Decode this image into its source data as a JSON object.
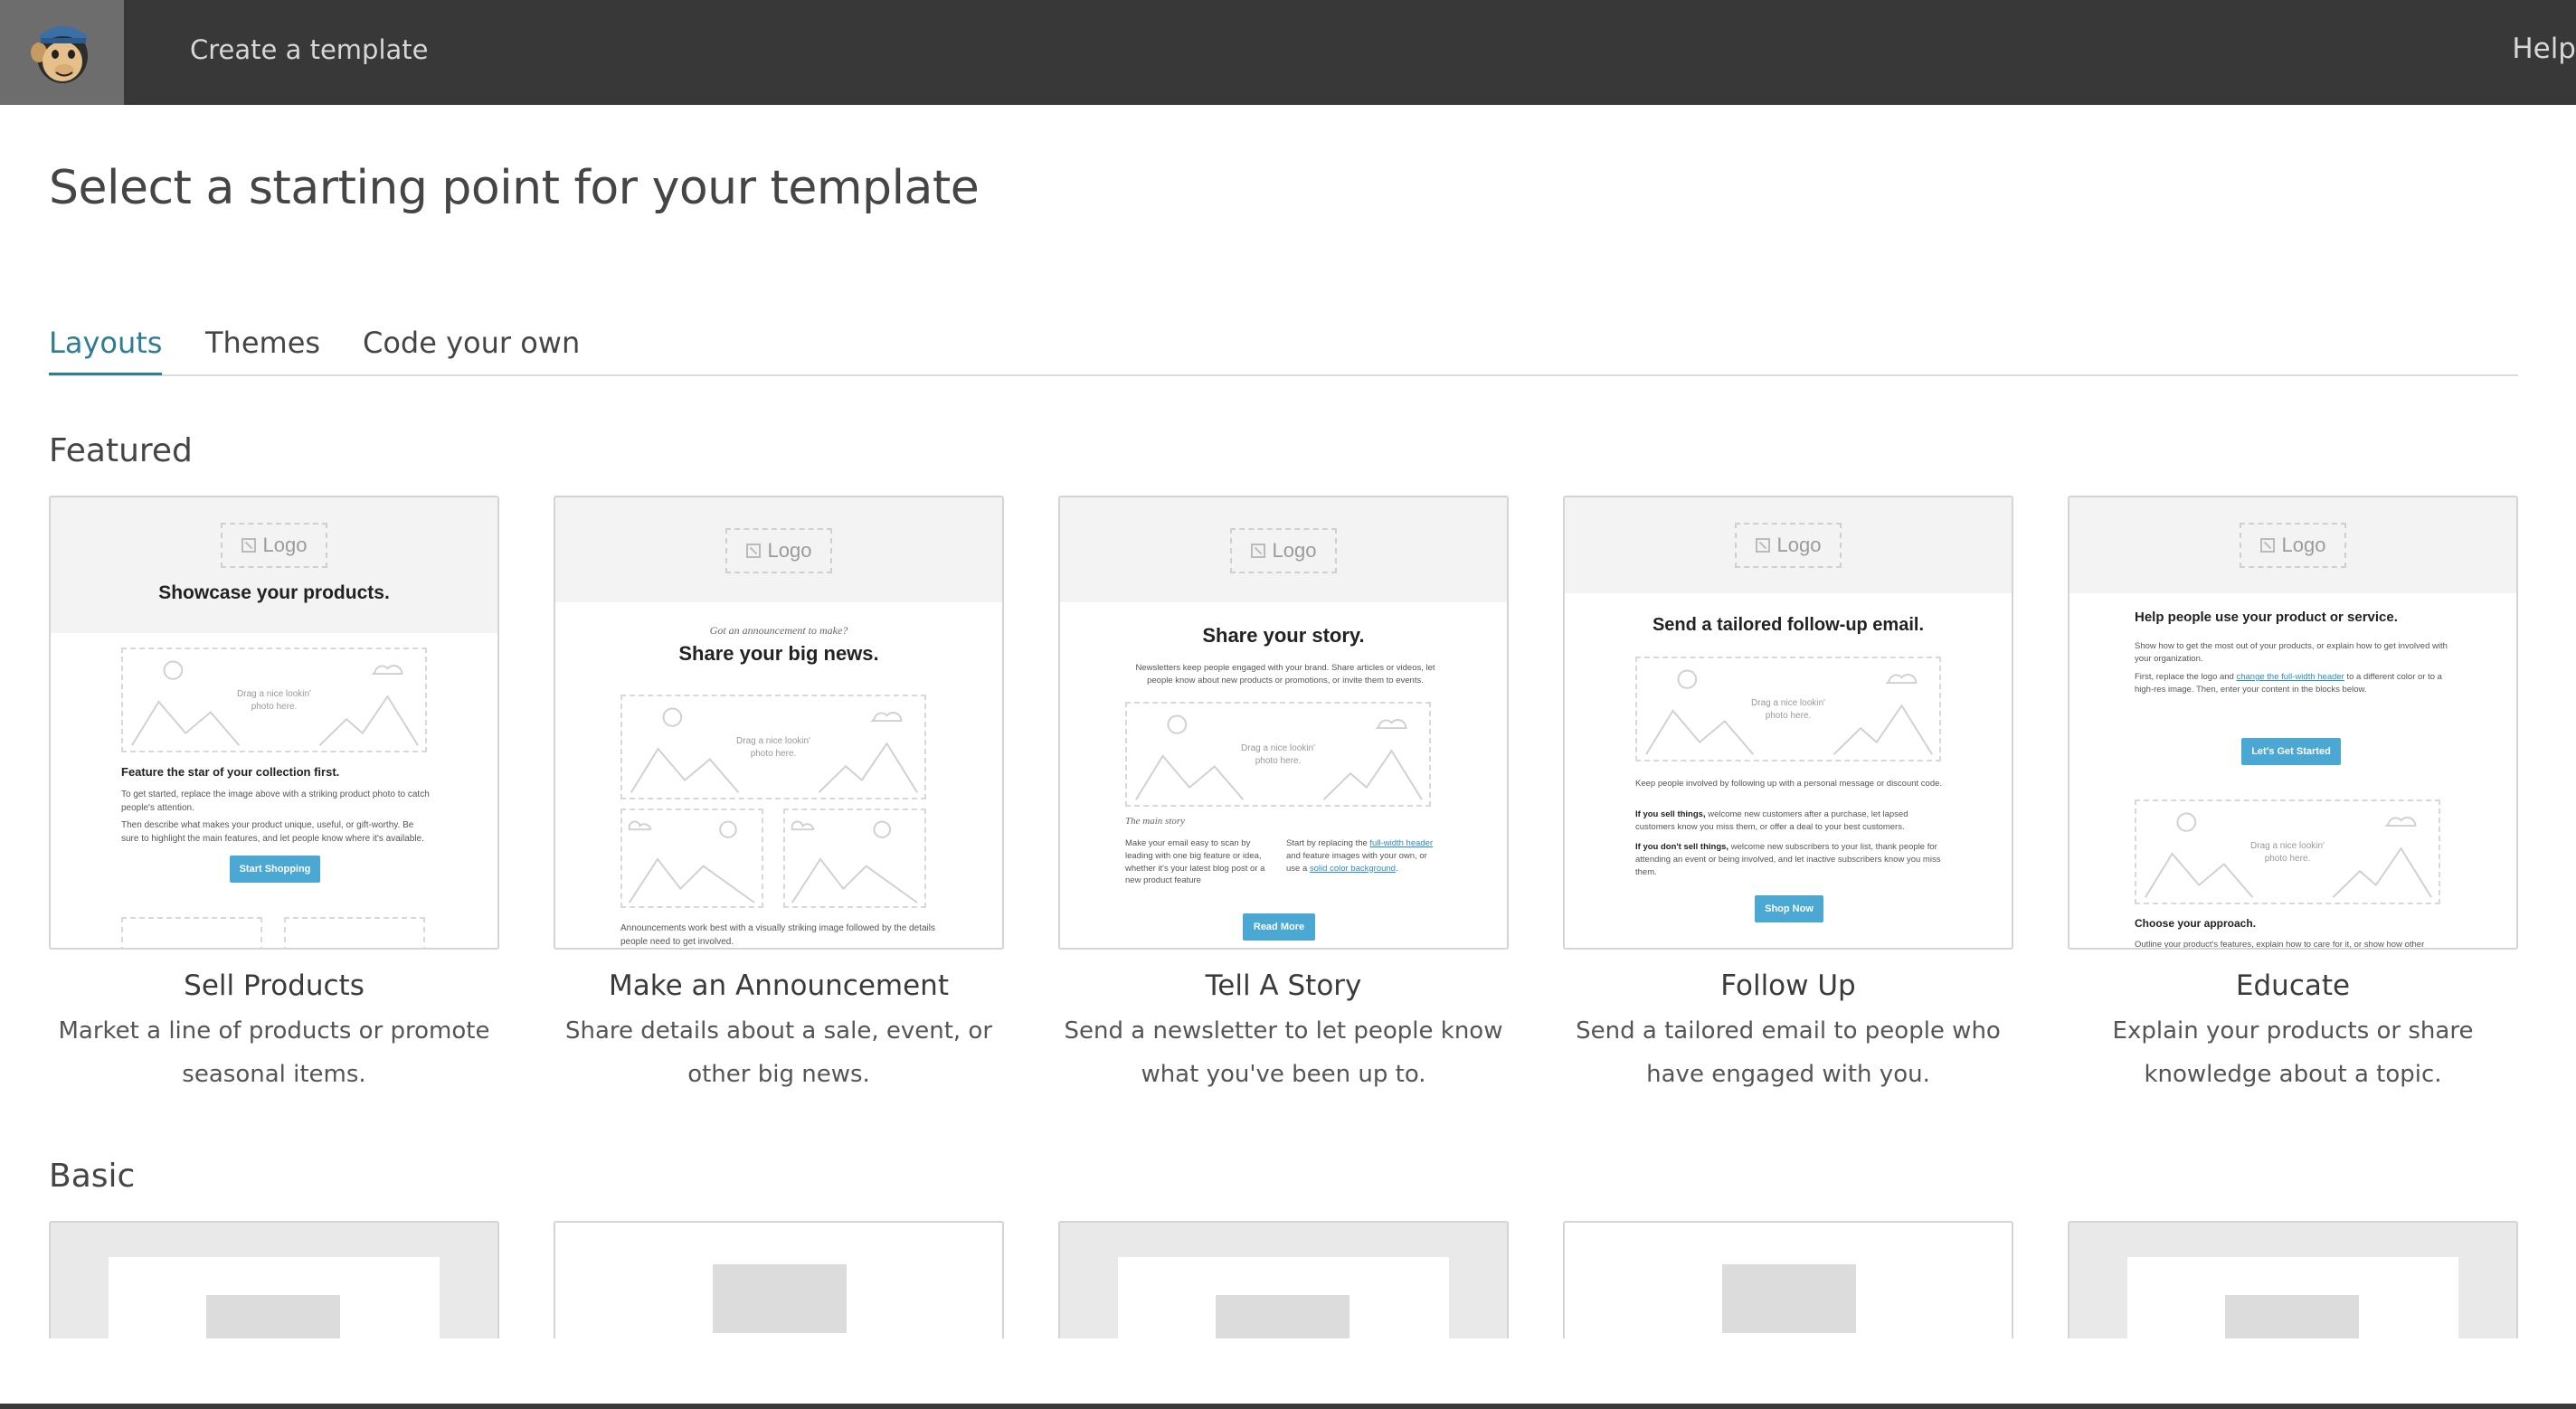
{
  "topbar": {
    "title": "Create a template",
    "help": "Help"
  },
  "page": {
    "title": "Select a starting point for your template"
  },
  "tabs": [
    {
      "label": "Layouts",
      "active": true
    },
    {
      "label": "Themes",
      "active": false
    },
    {
      "label": "Code your own",
      "active": false
    }
  ],
  "sections": {
    "featured": "Featured",
    "basic": "Basic"
  },
  "colors": {
    "topbar": "#383838",
    "accent": "#2e7d94",
    "button": "#4aa8d3"
  },
  "thumbs": {
    "logo": "Logo",
    "drag_line1": "Drag a nice lookin'",
    "drag_line2": "photo here.",
    "sell": {
      "headline": "Showcase your products.",
      "subhead": "Feature the star of your collection first.",
      "p1": "To get started, replace the image above with a striking product photo to catch people's attention.",
      "p2": "Then describe what makes your product unique, useful, or gift-worthy. Be sure to highlight the main features, and let people know where it's available.",
      "button": "Start Shopping"
    },
    "announce": {
      "kicker": "Got an announcement to make?",
      "headline": "Share your big news.",
      "p1": "Announcements work best with a visually striking image followed by the details people need to get involved."
    },
    "story": {
      "headline": "Share your story.",
      "p1": "Newsletters keep people engaged with your brand. Share articles or videos, let people know about new products or promotions, or invite them to events.",
      "label": "The main story",
      "col1": "Make your email easy to scan by leading with one big feature or idea, whether it's your latest blog post or a new product feature",
      "col2_a": "Start by replacing the ",
      "col2_link1": "full-width header",
      "col2_b": " and feature images with your own, or use a ",
      "col2_link2": "solid color background",
      "col2_c": ".",
      "button": "Read More"
    },
    "follow": {
      "headline": "Send a tailored follow-up email.",
      "p1": "Keep people involved by following up with a personal message or discount code.",
      "p2_bold": "If you sell things,",
      "p2": " welcome new customers after a purchase, let lapsed customers know you miss them, or offer a deal to your best customers.",
      "p3_bold": "If you don't sell things,",
      "p3": " welcome new subscribers to your list, thank people for attending an event or being involved, and let inactive subscribers know you miss them.",
      "button": "Shop Now"
    },
    "educate": {
      "headline": "Help people use your product or service.",
      "p1": "Show how to get the most out of your products, or explain how to get involved with your organization.",
      "p2_a": "First, replace the logo and ",
      "p2_link": "change the full-width header",
      "p2_b": " to a different color or to a high-res image. Then, enter your content in the blocks below.",
      "button": "Let's Get Started",
      "subhead": "Choose your approach.",
      "p3": "Outline your product's features, explain how to care for it, or show how other"
    }
  },
  "featured": [
    {
      "name": "Sell Products",
      "desc": "Market a line of products or promote seasonal items."
    },
    {
      "name": "Make an Announcement",
      "desc": "Share details about a sale, event, or other big news."
    },
    {
      "name": "Tell A Story",
      "desc": "Send a newsletter to let people know what you've been up to."
    },
    {
      "name": "Follow Up",
      "desc": "Send a tailored email to people who have engaged with you."
    },
    {
      "name": "Educate",
      "desc": "Explain your products or share knowledge about a topic."
    }
  ]
}
